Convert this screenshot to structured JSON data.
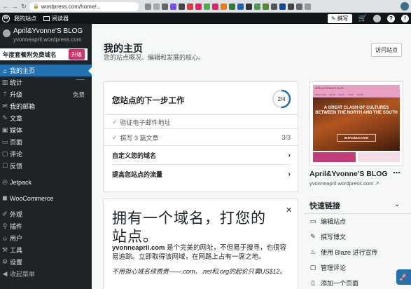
{
  "browser": {
    "url": "wordpress.com/home/...",
    "back_icon": "back-arrow-icon",
    "forward_icon": "forward-arrow-icon",
    "reload_icon": "reload-icon"
  },
  "adminbar": {
    "my_sites": "我的站点",
    "reader": "阅读器",
    "write": "撰写"
  },
  "sidebar": {
    "site_title": "April&Yvonne'S BLOG",
    "site_url": "yvonneapril.wordpress.com",
    "promo_text": "年度套餐附免费域名",
    "promo_button": "升级",
    "items": [
      {
        "label": "我的主页",
        "icon": "house-icon",
        "active": true
      },
      {
        "label": "统计",
        "icon": "chart-icon"
      },
      {
        "label": "升级",
        "icon": "upgrade-icon",
        "badge": "免费"
      },
      {
        "label": "我的邮箱",
        "icon": "mail-icon"
      },
      {
        "label": "文章",
        "icon": "pin-icon"
      },
      {
        "label": "媒体",
        "icon": "media-icon"
      },
      {
        "label": "页面",
        "icon": "page-icon"
      },
      {
        "label": "评论",
        "icon": "comment-icon"
      },
      {
        "label": "反馈",
        "icon": "feedback-icon"
      },
      {
        "label": "Jetpack",
        "icon": "jetpack-icon"
      },
      {
        "label": "WooCommerce",
        "icon": "woocommerce-icon"
      },
      {
        "label": "外观",
        "icon": "brush-icon"
      },
      {
        "label": "插件",
        "icon": "plugin-icon"
      },
      {
        "label": "用户",
        "icon": "user-icon"
      },
      {
        "label": "工具",
        "icon": "wrench-icon"
      },
      {
        "label": "设置",
        "icon": "settings-icon"
      },
      {
        "label": "收起菜单",
        "icon": "collapse-icon"
      }
    ]
  },
  "main": {
    "title": "我的主页",
    "subtitle": "您的站点概况、编辑和发展的核心。",
    "visit_button": "访问站点",
    "next_steps": {
      "title": "您站点的下一步工作",
      "progress": "2/4",
      "progress_fraction": 0.5,
      "tasks": [
        {
          "label": "验证电子邮件地址",
          "done": true
        },
        {
          "label": "撰写 3 篇文章",
          "done": true,
          "count": "3/3"
        },
        {
          "label": "自定义您的域名",
          "done": false
        },
        {
          "label": "提高您站点的流量",
          "done": false
        }
      ]
    },
    "domain_card": {
      "headline": "拥有一个域名，打您的站点。",
      "description_bold": "yvonneapril.com",
      "description": " 是个完美的网址，不但易于搜寻，也很容易追踪。立即取得该网域，在网路上占有一席之地。",
      "note": "不用担心域名续费贵——.com、.net和.org的起价只需US$12。"
    },
    "site_card": {
      "name": "April&Yvonne'S BLOG",
      "url": "yvonneapril.wordpress.com",
      "preview_header": "APRIL&YVONNE'S BLOG",
      "preview_nav": [
        "ABOUT ME",
        "BLOG",
        "BLOG",
        "NOW",
        "MORE"
      ],
      "preview_hero": "A GREAT CLASH OF CULTURES BETWEEN THE NORTH AND THE SOUTH",
      "preview_intro": "INTRODUCTION"
    },
    "quick_links": {
      "title": "快速链接",
      "items": [
        {
          "label": "编辑站点",
          "icon": "laptop-icon"
        },
        {
          "label": "撰写博文",
          "icon": "pencil-icon"
        },
        {
          "label": "使用 Blaze 进行宣传",
          "icon": "flame-icon"
        },
        {
          "label": "管理评论",
          "icon": "comment-icon"
        },
        {
          "label": "添加一个页面",
          "icon": "page-icon"
        }
      ]
    }
  },
  "colors": {
    "accent": "#2271b1",
    "sidebar_bg": "#1d2327",
    "adminbar_bg": "#101517",
    "upgrade_pink": "#c9356e"
  }
}
